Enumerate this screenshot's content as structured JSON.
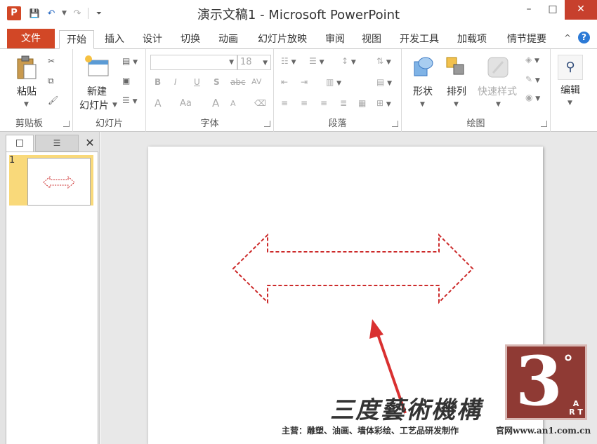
{
  "window": {
    "app_icon": "P",
    "title": "演示文稿1 - Microsoft PowerPoint",
    "minimize": "–",
    "maximize": "□",
    "close": "✕"
  },
  "qat": {
    "save": "💾",
    "undo": "↶",
    "redo": "↷",
    "more": "⏷"
  },
  "tabs": {
    "file": "文件",
    "items": [
      "开始",
      "插入",
      "设计",
      "切换",
      "动画",
      "幻灯片放映",
      "审阅",
      "视图",
      "开发工具",
      "加载项",
      "情节提要"
    ],
    "collapse": "^",
    "help": "?"
  },
  "ribbon": {
    "clipboard": {
      "label": "剪贴板",
      "paste": "粘贴"
    },
    "slides": {
      "label": "幻灯片",
      "new_slide_1": "新建",
      "new_slide_2": "幻灯片"
    },
    "font": {
      "label": "字体",
      "font_size": "18",
      "bold": "B",
      "italic": "I",
      "underline": "U",
      "shadow": "S",
      "strike": "abc",
      "spacing": "AV",
      "color": "A",
      "case": "Aa",
      "grow": "A",
      "shrink": "A"
    },
    "paragraph": {
      "label": "段落"
    },
    "drawing": {
      "label": "绘图",
      "shapes": "形状",
      "arrange": "排列",
      "quick_styles": "快速样式"
    },
    "editing": {
      "label": "编辑"
    }
  },
  "left_pane": {
    "slide_number": "1",
    "close": "✕"
  },
  "watermark": {
    "logo_digit": "3",
    "logo_degree": "°",
    "logo_art": "A R T",
    "name": "三度藝術機構",
    "footer_left": "主营：雕塑、油画、墙体彩绘、工艺品研发制作",
    "footer_right": "官网www.an1.com.cn"
  },
  "colors": {
    "accent": "#d24726",
    "arrow_outline": "#cc2a2a",
    "pointer_arrow": "#d93030"
  }
}
